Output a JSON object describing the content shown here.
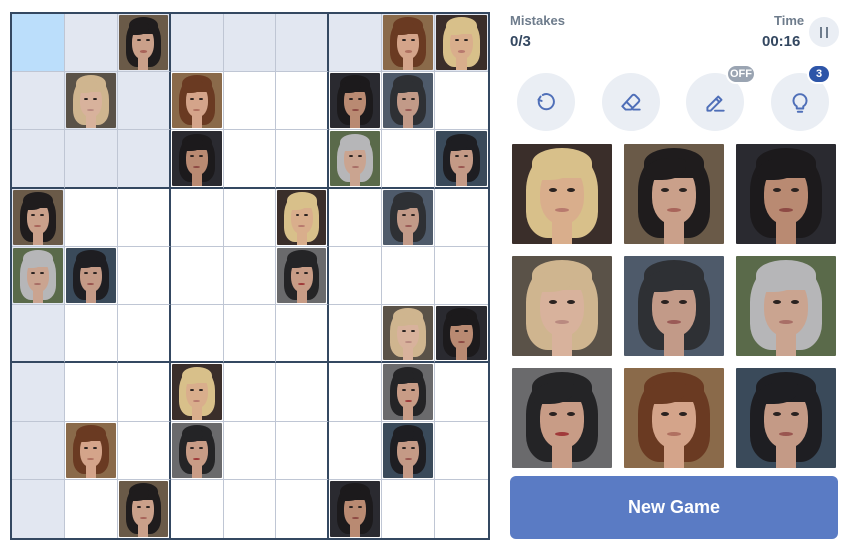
{
  "header": {
    "mistakes_label": "Mistakes",
    "mistakes_value": "0/3",
    "time_label": "Time",
    "time_value": "00:16"
  },
  "tools": [
    {
      "name": "undo-button",
      "icon": "undo-icon"
    },
    {
      "name": "erase-button",
      "icon": "eraser-icon"
    },
    {
      "name": "notes-button",
      "icon": "pencil-icon",
      "badge": "OFF"
    },
    {
      "name": "hint-button",
      "icon": "lightbulb-icon",
      "badge": "3"
    }
  ],
  "new_game_label": "New Game",
  "colors": {
    "accent": "#5a7bc4",
    "grid_border": "#344861",
    "highlight": "#e2e7f1",
    "selected": "#bbdefb"
  },
  "faces": {
    "1": {
      "desc": "blonde bob woman",
      "hair": "#d8c08a",
      "skin": "#d9ae8c",
      "bg": "#3a2e2a",
      "lip": "#b87a6e"
    },
    "2": {
      "desc": "dark long hair woman",
      "hair": "#1f1c1d",
      "skin": "#caa08a",
      "bg": "#6a5a48",
      "lip": "#a8645a"
    },
    "3": {
      "desc": "dark hair woman, side part",
      "hair": "#1c1a1c",
      "skin": "#b98a72",
      "bg": "#2a2a30",
      "lip": "#8e4a44"
    },
    "4": {
      "desc": "blonde short hair woman",
      "hair": "#cfb58f",
      "skin": "#d8b29c",
      "bg": "#5a5248",
      "lip": "#b98a80"
    },
    "5": {
      "desc": "black bob with grey streaks",
      "hair": "#2e3034",
      "skin": "#c29a88",
      "bg": "#4e5a6a",
      "lip": "#9a5a56"
    },
    "6": {
      "desc": "silver hair woman",
      "hair": "#b6b6b8",
      "skin": "#caa490",
      "bg": "#5a6a4a",
      "lip": "#a86e66"
    },
    "7": {
      "desc": "dark hair over eye",
      "hair": "#242426",
      "skin": "#c89c86",
      "bg": "#6a6a6c",
      "lip": "#a03a3a"
    },
    "8": {
      "desc": "auburn hair woman",
      "hair": "#6a3a22",
      "skin": "#d4a48a",
      "bg": "#8a6a4a",
      "lip": "#b07060"
    },
    "9": {
      "desc": "dark short hair woman",
      "hair": "#1e1e22",
      "skin": "#c49a86",
      "bg": "#3a4a5a",
      "lip": "#9a5650"
    }
  },
  "board": [
    [
      0,
      0,
      2,
      0,
      0,
      0,
      0,
      8,
      1
    ],
    [
      0,
      4,
      0,
      8,
      0,
      0,
      3,
      5,
      0
    ],
    [
      0,
      0,
      0,
      3,
      0,
      0,
      6,
      0,
      9
    ],
    [
      2,
      0,
      0,
      0,
      0,
      1,
      0,
      5,
      0
    ],
    [
      6,
      9,
      0,
      0,
      0,
      7,
      0,
      0,
      0
    ],
    [
      0,
      0,
      0,
      0,
      0,
      0,
      0,
      4,
      3
    ],
    [
      0,
      0,
      0,
      1,
      0,
      0,
      0,
      7,
      0
    ],
    [
      0,
      8,
      0,
      7,
      0,
      0,
      0,
      9,
      0
    ],
    [
      0,
      0,
      2,
      0,
      0,
      0,
      3,
      0,
      0
    ]
  ],
  "pad": [
    1,
    2,
    3,
    4,
    5,
    6,
    7,
    8,
    9
  ]
}
